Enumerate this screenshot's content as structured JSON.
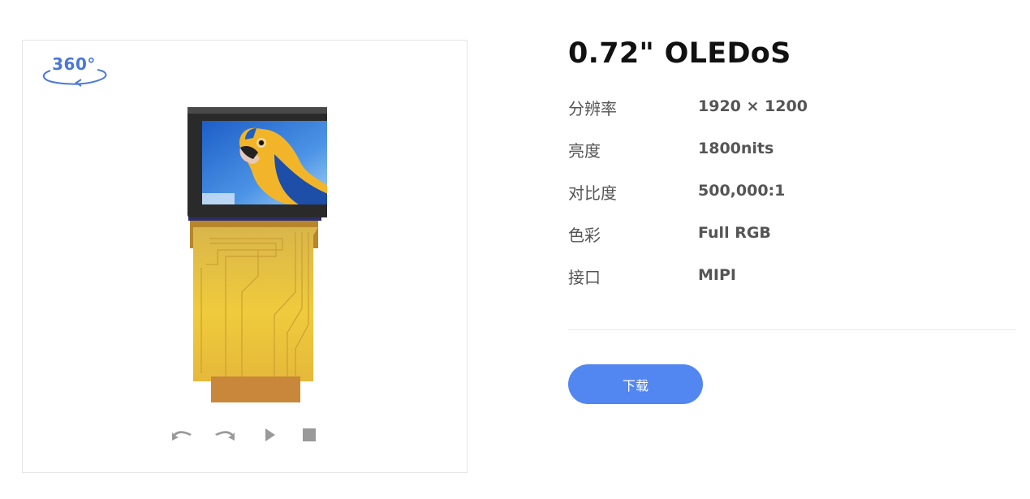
{
  "viewer": {
    "badge_text": "360°",
    "badge_icon": "rotate-360-icon",
    "controls": [
      {
        "name": "rotate-left-button",
        "icon": "rotate-left-icon"
      },
      {
        "name": "rotate-right-button",
        "icon": "rotate-right-icon"
      },
      {
        "name": "play-button",
        "icon": "play-icon"
      },
      {
        "name": "stop-button",
        "icon": "stop-icon"
      }
    ]
  },
  "product": {
    "title": "0.72\" OLEDoS",
    "specs": [
      {
        "key": "分辨率",
        "value": "1920 × 1200"
      },
      {
        "key": "亮度",
        "value": "1800nits"
      },
      {
        "key": "对比度",
        "value": "500,000:1"
      },
      {
        "key": "色彩",
        "value": "Full RGB"
      },
      {
        "key": "接口",
        "value": "MIPI"
      }
    ],
    "download_label": "下载"
  },
  "colors": {
    "accent": "#5286f0",
    "badge": "#4a78d6",
    "control_gray": "#9a9a9a",
    "flex_cable": "#e9c13a"
  }
}
